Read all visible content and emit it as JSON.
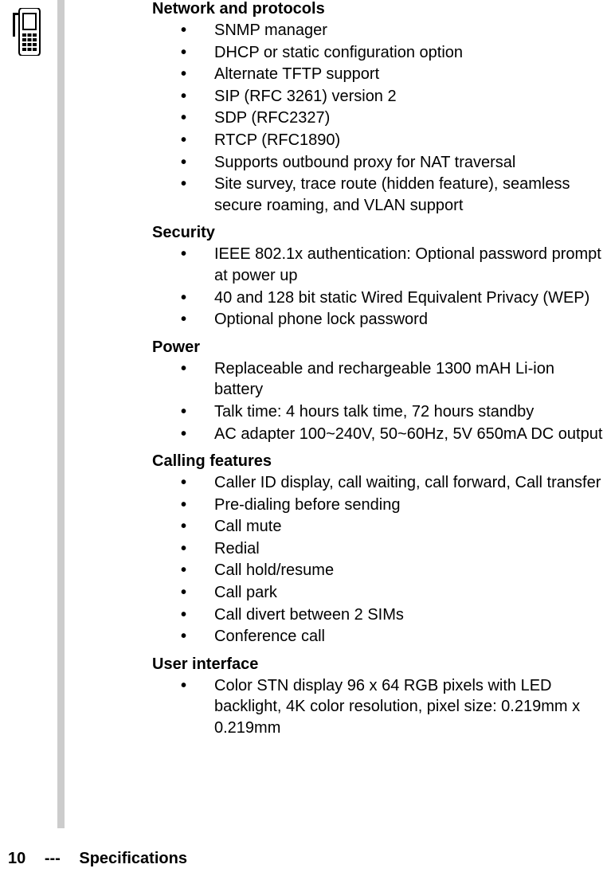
{
  "sections": [
    {
      "title": "Network and protocols",
      "items": [
        "SNMP manager",
        "DHCP or static configuration option",
        "Alternate TFTP support",
        "SIP (RFC 3261) version 2",
        "SDP (RFC2327)",
        "RTCP (RFC1890)",
        "Supports outbound proxy for NAT traversal",
        "Site survey, trace route (hidden feature), seamless secure roaming, and VLAN support"
      ]
    },
    {
      "title": "Security",
      "items": [
        "IEEE 802.1x authentication: Optional password prompt at power up",
        "40 and 128 bit static Wired Equivalent Privacy (WEP)",
        "Optional phone lock password"
      ]
    },
    {
      "title": "Power",
      "items": [
        "Replaceable and rechargeable 1300 mAH Li-ion battery",
        "Talk time: 4 hours talk time, 72 hours standby",
        "AC adapter 100~240V, 50~60Hz, 5V 650mA DC output"
      ]
    },
    {
      "title": "Calling features",
      "items": [
        "Caller ID display, call waiting, call forward, Call transfer",
        "Pre-dialing before sending",
        "Call mute",
        "Redial",
        "Call hold/resume",
        "Call park",
        "Call divert between 2 SIMs",
        "Conference call"
      ]
    },
    {
      "title": "User interface",
      "items": [
        "Color STN display 96 x 64 RGB pixels with LED backlight, 4K color resolution, pixel size: 0.219mm x 0.219mm"
      ]
    }
  ],
  "footer": {
    "page_number": "10",
    "separator": "---",
    "label": "Specifications"
  }
}
